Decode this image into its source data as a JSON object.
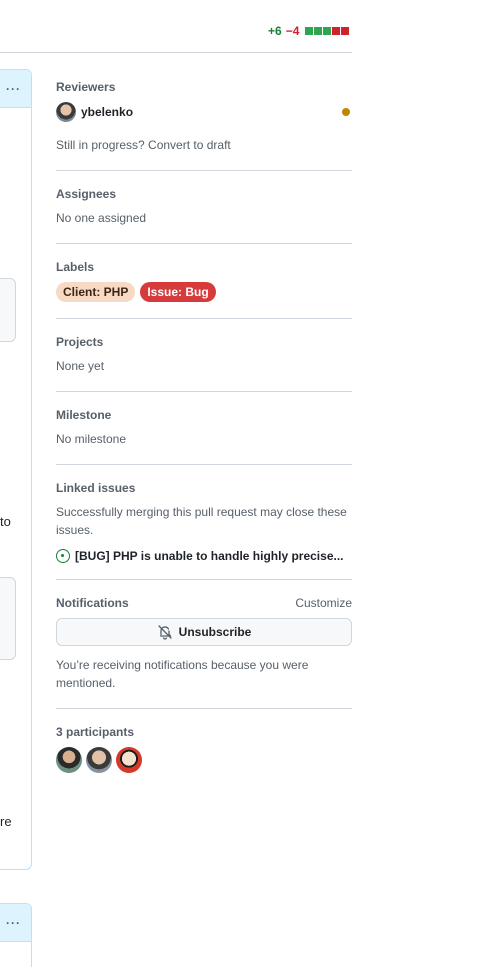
{
  "diffstat": {
    "additions": "+6",
    "deletions": "−4"
  },
  "timeline_fragments": {
    "text_1": "to",
    "text_2": "re",
    "menu_dots": "···"
  },
  "reviewers": {
    "heading": "Reviewers",
    "items": [
      {
        "name": "ybelenko",
        "status": "pending"
      }
    ],
    "draft_hint": "Still in progress? Convert to draft"
  },
  "assignees": {
    "heading": "Assignees",
    "value": "No one assigned"
  },
  "labels": {
    "heading": "Labels",
    "items": [
      {
        "name": "Client: PHP",
        "color": "#f7d9c4"
      },
      {
        "name": "Issue: Bug",
        "color": "#d73a3a"
      }
    ]
  },
  "projects": {
    "heading": "Projects",
    "value": "None yet"
  },
  "milestone": {
    "heading": "Milestone",
    "value": "No milestone"
  },
  "linked_issues": {
    "heading": "Linked issues",
    "description": "Successfully merging this pull request may close these issues.",
    "items": [
      {
        "title": "[BUG] PHP is unable to handle highly precise..."
      }
    ]
  },
  "notifications": {
    "heading": "Notifications",
    "customize_label": "Customize",
    "button_label": "Unsubscribe",
    "reason": "You’re receiving notifications because you were mentioned."
  },
  "participants": {
    "heading": "3 participants",
    "count": 3
  },
  "colors": {
    "accent_green": "#1a7f37",
    "accent_red": "#cf222e",
    "pending": "#bf8700"
  },
  "icons": {
    "bell_slash": "bell-slash-icon",
    "issue_open": "issue-opened-icon",
    "kebab": "kebab-horizontal-icon"
  }
}
